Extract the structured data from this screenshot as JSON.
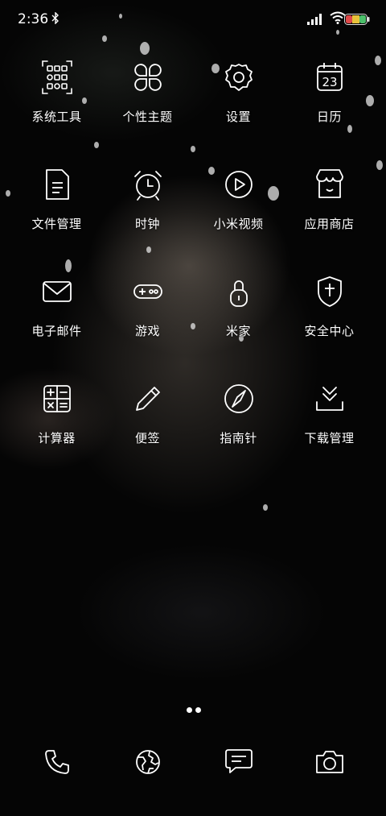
{
  "status_bar": {
    "time": "2:36",
    "icons": [
      "bluetooth-icon",
      "signal-icon",
      "wifi-icon",
      "battery-icon"
    ]
  },
  "apps": [
    {
      "label": "系统工具",
      "icon": "tools-folder-icon"
    },
    {
      "label": "个性主题",
      "icon": "theme-icon"
    },
    {
      "label": "设置",
      "icon": "gear-icon"
    },
    {
      "label": "日历",
      "icon": "calendar-icon",
      "calendar_day": "23"
    },
    {
      "label": "文件管理",
      "icon": "file-icon"
    },
    {
      "label": "时钟",
      "icon": "alarm-clock-icon"
    },
    {
      "label": "小米视频",
      "icon": "video-play-icon"
    },
    {
      "label": "应用商店",
      "icon": "store-icon"
    },
    {
      "label": "电子邮件",
      "icon": "mail-icon"
    },
    {
      "label": "游戏",
      "icon": "gamepad-icon"
    },
    {
      "label": "米家",
      "icon": "lock-icon"
    },
    {
      "label": "安全中心",
      "icon": "shield-icon"
    },
    {
      "label": "计算器",
      "icon": "calculator-icon"
    },
    {
      "label": "便签",
      "icon": "pencil-icon"
    },
    {
      "label": "指南针",
      "icon": "compass-icon"
    },
    {
      "label": "下载管理",
      "icon": "download-icon"
    }
  ],
  "page_indicator": {
    "pages": 2,
    "current": 1
  },
  "dock": [
    {
      "icon": "phone-icon"
    },
    {
      "icon": "browser-globe-icon"
    },
    {
      "icon": "messages-icon"
    },
    {
      "icon": "camera-icon"
    }
  ]
}
